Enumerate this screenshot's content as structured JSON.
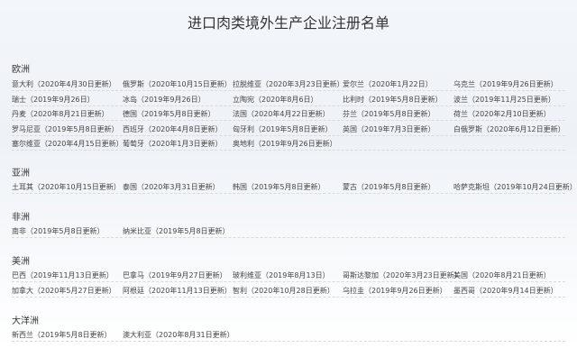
{
  "page": {
    "title": "进口肉类境外生产企业注册名单"
  },
  "regions": [
    {
      "name": "欧洲",
      "rows": [
        [
          "意大利（2020年4月30日更新）",
          "俄罗斯（2020年10月15日更新）",
          "拉脱维亚（2020年3月23日更新）",
          "爱尔兰（2020年1月22日）",
          "乌克兰（2019年9月26日更新）"
        ],
        [
          "瑞士（2019年9月26日）",
          "冰岛（2019年9月26日）",
          "立陶宛（2020年8月6日）",
          "比利时（2019年5月8日更新）",
          "波兰（2019年11月25日更新）"
        ],
        [
          "丹麦（2020年8月21日更新）",
          "德国（2019年5月8日更新）",
          "法国（2020年4月22日更新）",
          "芬兰（2019年5月8日更新）",
          "荷兰（2020年2月10日更新）"
        ],
        [
          "罗马尼亚（2019年5月8日更新）",
          "西班牙（2020年4月8日更新）",
          "匈牙利（2019年5月8日更新）",
          "英国（2019年7月3日更新）",
          "白俄罗斯（2020年6月12日更新）"
        ],
        [
          "塞尔维亚（2020年4月15日更新）",
          "葡萄牙（2020年1月3日更新）",
          "奥地利（2019年9月26日更新）"
        ]
      ]
    },
    {
      "name": "亚洲",
      "rows": [
        [
          "土耳其（2020年10月15日更新）",
          "泰国（2020年3月31日更新）",
          "韩国（2019年5月8日更新）",
          "蒙古（2019年5月8日更新）",
          "哈萨克斯坦（2019年10月24日更新）"
        ]
      ]
    },
    {
      "name": "非洲",
      "rows": [
        [
          "南非（2019年5月8日更新）",
          "纳米比亚（2019年5月8日更新）"
        ]
      ]
    },
    {
      "name": "美洲",
      "rows": [
        [
          "巴西（2019年11月13日更新）",
          "巴拿马（2019年9月27日更新）",
          "玻利维亚（2019年8月13日）",
          "哥斯达黎加（2020年3月23日更新）",
          "美国（2020年8月21日更新）"
        ],
        [
          "加拿大（2020年5月27日更新）",
          "阿根廷（2020年11月13日更新）",
          "智利（2020年10月28日更新）",
          "乌拉圭（2019年9月26日更新）",
          "墨西哥（2020年9月14日更新）"
        ]
      ]
    },
    {
      "name": "大洋洲",
      "rows": [
        [
          "新西兰（2019年5月8日更新）",
          "澳大利亚（2020年8月31日更新）"
        ]
      ]
    }
  ]
}
